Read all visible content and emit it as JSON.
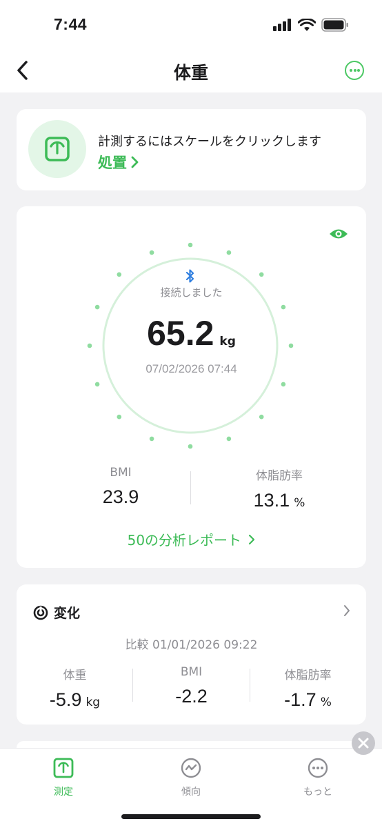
{
  "status_bar": {
    "time": "7:44"
  },
  "nav": {
    "title": "体重"
  },
  "hint_card": {
    "text": "計測するにはスケールをクリックします",
    "link_label": "処置"
  },
  "measurement": {
    "connection_status": "接続しました",
    "weight": "65.2",
    "weight_unit": "kg",
    "timestamp": "07/02/2026 07:44",
    "bmi_label": "BMI",
    "bmi_value": "23.9",
    "body_fat_label": "体脂肪率",
    "body_fat_value": "13.1",
    "body_fat_unit": "%",
    "report_link": "50の分析レポート"
  },
  "change_card": {
    "title": "変化",
    "compare_text": "比較 01/01/2026 09:22",
    "stats": [
      {
        "label": "体重",
        "value": "-5.9",
        "unit": "kg"
      },
      {
        "label": "BMI",
        "value": "-2.2",
        "unit": ""
      },
      {
        "label": "体脂肪率",
        "value": "-1.7",
        "unit": "%"
      }
    ]
  },
  "tabs": [
    {
      "label": "測定",
      "icon": "scale-icon",
      "active": true
    },
    {
      "label": "傾向",
      "icon": "trend-icon",
      "active": false
    },
    {
      "label": "もっと",
      "icon": "more-icon",
      "active": false
    }
  ],
  "colors": {
    "accent": "#3dbb57",
    "accent_light": "#e3f6e7",
    "bluetooth": "#2f7fe0",
    "background": "#f2f2f4"
  }
}
